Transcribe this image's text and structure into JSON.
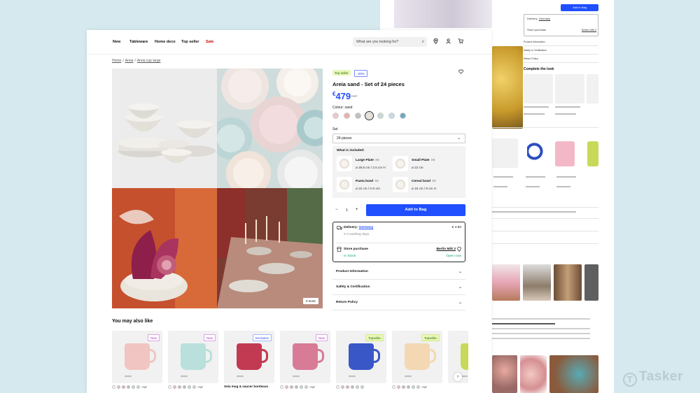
{
  "nav": {
    "items": [
      "New",
      "Tableware",
      "Home deco",
      "Top seller",
      "Sale"
    ],
    "search_placeholder": "What are you looking for?",
    "icons": [
      "search-icon",
      "location-icon",
      "user-icon",
      "cart-icon"
    ]
  },
  "breadcrumb": [
    "Home",
    "Areia",
    "Areia cup large"
  ],
  "product": {
    "badge_top": "Top seller",
    "badge_discount": "-20%",
    "title": "Areia sand - Set of 24 pieces",
    "currency": "€",
    "price": "479",
    "rrp": "RRP",
    "colour_label": "Colour: sand",
    "swatches": [
      "#e9c9cf",
      "#e6b2ae",
      "#bcbfc4",
      "#e9e3d9",
      "#c8d8d4",
      "#c7dbe6",
      "#6fa6c1"
    ],
    "set_label": "Set",
    "set_value": "24 pieces",
    "included_title": "What is included:",
    "included": [
      {
        "name": "Large Plate",
        "qty": "X6",
        "dim": "ø 28.5 cm / 2.5 cm H"
      },
      {
        "name": "Small Plate",
        "qty": "X6",
        "dim": "ø 22 cm"
      },
      {
        "name": "Pasta bowl",
        "qty": "X6",
        "dim": "ø 22 cm / H 5 cm"
      },
      {
        "name": "Cereal bowl",
        "qty": "X6",
        "dim": "ø 15 cm / 8 cm H"
      }
    ],
    "qty": "1",
    "add_to_bag": "Add to Bag",
    "delivery": {
      "label": "Delivery:",
      "country": "Germany",
      "price": "€ 4.50",
      "eta": "2-4 working days",
      "store_label": "Store purchase",
      "store_name": "Berlin Mitt 2",
      "stock": "In Stock",
      "open": "Open now"
    },
    "accordions": [
      "Product Information",
      "Safety & Certification",
      "Return Policy"
    ],
    "more_photos": "4 more"
  },
  "recommendations": {
    "title": "You may also like",
    "items": [
      {
        "badge": "New",
        "badge_type": "new",
        "color": "#f1c5c1",
        "extra": "+12",
        "name": ""
      },
      {
        "badge": "New",
        "badge_type": "new",
        "color": "#b9e0dc",
        "extra": "+12",
        "name": ""
      },
      {
        "badge": "Exclusive",
        "badge_type": "excl",
        "color": "#c23a52",
        "extra": "",
        "name": "Seia mug & saucer bordeaux"
      },
      {
        "badge": "New",
        "badge_type": "new",
        "color": "#d87b97",
        "extra": "+12",
        "name": ""
      },
      {
        "badge": "Topseller",
        "badge_type": "top",
        "color": "#3a57c8",
        "extra": "",
        "name": ""
      },
      {
        "badge": "Topseller",
        "badge_type": "top",
        "color": "#f3d8b3",
        "extra": "+12",
        "name": ""
      },
      {
        "badge": "",
        "badge_type": "",
        "color": "#c8d95a",
        "extra": "",
        "name": ""
      }
    ]
  },
  "background_page": {
    "add_to_bag": "Add to Bag",
    "delivery_label": "Delivery:",
    "delivery_country": "Germany",
    "store_label": "Store purchase",
    "store_name": "Berlin Mitt 2",
    "accordions": [
      "Product Information",
      "Safety & Certification",
      "Return Policy"
    ],
    "complete_look": "Complete the look"
  },
  "brand": "Tasker"
}
